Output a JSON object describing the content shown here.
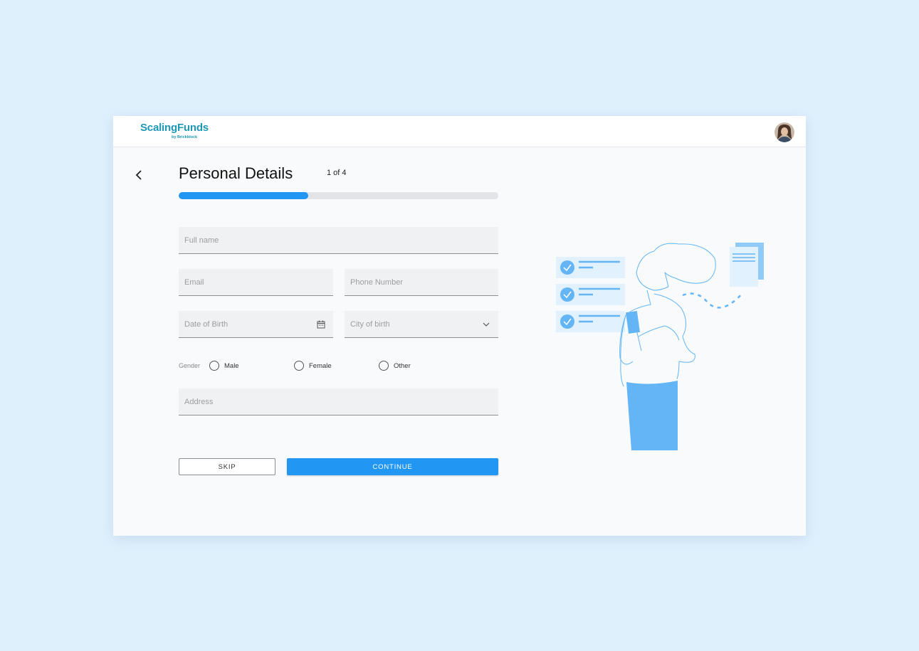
{
  "app": {
    "logo_text": "ScalingFunds",
    "logo_subtext": "by Brickblock",
    "avatar_alt": "user avatar"
  },
  "page": {
    "title": "Personal Details",
    "step": "1 of 4",
    "progress": 0.405
  },
  "form": {
    "full_name": {
      "placeholder": "Full name",
      "value": ""
    },
    "email": {
      "placeholder": "Email",
      "value": ""
    },
    "phone": {
      "placeholder": "Phone Number",
      "value": ""
    },
    "dob": {
      "placeholder": "Date of Birth",
      "value": "",
      "icon": "calendar-icon"
    },
    "city": {
      "placeholder": "City of birth",
      "value": "",
      "icon": "chevron-down-icon"
    },
    "gender": {
      "label": "Gender",
      "options": [
        "Male",
        "Female",
        "Other"
      ],
      "selected": null
    },
    "address": {
      "placeholder": "Address",
      "value": ""
    }
  },
  "actions": {
    "skip_label": "SKIP",
    "continue_label": "CONTINUE"
  },
  "colors": {
    "background": "#dff0fd",
    "accent": "#2196f3",
    "brand": "#1c98b4",
    "illustration": "#64b5f6"
  },
  "icons": {
    "back": "chevron-left-icon"
  }
}
